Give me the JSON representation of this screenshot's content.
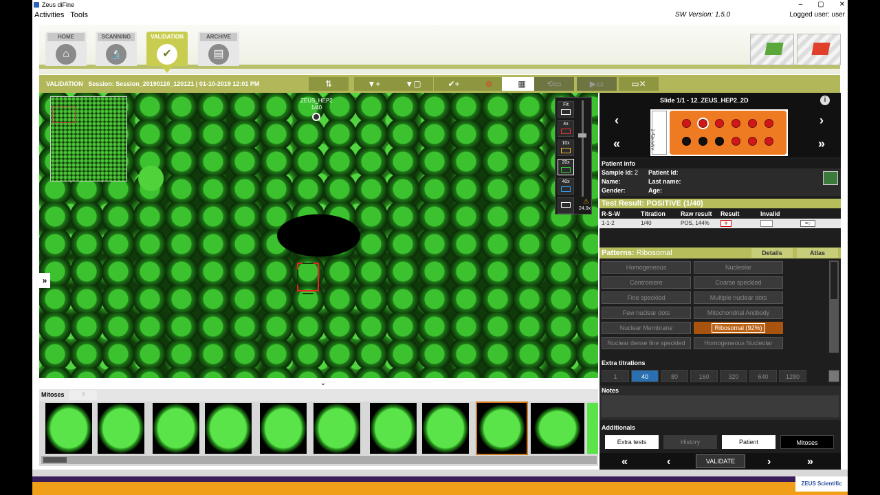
{
  "app": {
    "title": "Zeus diFine",
    "menu": [
      "Activities",
      "Tools"
    ],
    "version": "SW Version: 1.5.0",
    "user": "Logged user: user"
  },
  "window_controls": {
    "minimize": "–",
    "maximize": "▢",
    "close": "✕"
  },
  "nav": [
    {
      "label": "HOME",
      "icon": "home-icon",
      "glyph": "⌂"
    },
    {
      "label": "SCANNING",
      "icon": "microscope-icon",
      "glyph": "🔬"
    },
    {
      "label": "VALIDATION",
      "icon": "checklist-icon",
      "glyph": "✔"
    },
    {
      "label": "ARCHIVE",
      "icon": "archive-icon",
      "glyph": "▤"
    }
  ],
  "toolbar": {
    "title": "VALIDATION",
    "session": "Session: Session_20190110_120121 | 01-10-2019 12:01 PM",
    "buttons": [
      {
        "name": "sort-icon",
        "glyph": "⇅"
      },
      {
        "name": "filter-add-icon",
        "glyph": "▼+"
      },
      {
        "name": "filter-copy-icon",
        "glyph": "▼▢"
      },
      {
        "name": "check-add-icon",
        "glyph": "✔+"
      },
      {
        "name": "ban-icon",
        "glyph": "⊘"
      },
      {
        "name": "grid-icon",
        "glyph": "▦"
      },
      {
        "name": "link-icon",
        "glyph": "⟲▭"
      },
      {
        "name": "play-list-icon",
        "glyph": "▶▭"
      },
      {
        "name": "close-card-icon",
        "glyph": "▭✕"
      }
    ]
  },
  "viewer": {
    "specimen_name": "ZEUS_HEP2",
    "specimen_titer": "1/40",
    "expand_glyph": "»",
    "zoom": {
      "fit": "Fit",
      "levels": [
        "4x",
        "10x",
        "20x",
        "40x"
      ],
      "active": "20x",
      "value": "24.0x",
      "warning": "⚠"
    }
  },
  "mitoses": {
    "title": "Mitoses",
    "help": "?",
    "count": 10,
    "selected_index": 8
  },
  "slide": {
    "title": "Slide 1/1 - 12_ZEUS_HEP2_2D",
    "label": "ANA/HEp-2",
    "info": "i",
    "nav": {
      "prev": "‹",
      "next": "›",
      "first": "«",
      "last": "»"
    },
    "wells": [
      {
        "n": "1",
        "state": "red"
      },
      {
        "n": "2",
        "state": "selected"
      },
      {
        "n": "3",
        "state": "red"
      },
      {
        "n": "4",
        "state": "red"
      },
      {
        "n": "5",
        "state": "red"
      },
      {
        "n": "6",
        "state": "red"
      },
      {
        "n": "12",
        "state": "black"
      },
      {
        "n": "11",
        "state": "black"
      },
      {
        "n": "10",
        "state": "black"
      },
      {
        "n": "9",
        "state": "red"
      },
      {
        "n": "8",
        "state": "red"
      },
      {
        "n": "7",
        "state": "red"
      }
    ]
  },
  "patient": {
    "header": "Patient info",
    "sample_id_label": "Sample Id:",
    "sample_id": "2",
    "name_label": "Name:",
    "gender_label": "Gender:",
    "patient_id_label": "Patient Id:",
    "last_name_label": "Last name:",
    "age_label": "Age:"
  },
  "test_result": {
    "header": "Test Result: POSITIVE (1/40)",
    "columns": [
      "R-S-W",
      "Titration",
      "Raw result",
      "Result",
      "Invalid"
    ],
    "row": {
      "rsw": "1-1-2",
      "titration": "1/40",
      "raw": "POS, 144%",
      "result": "+",
      "icon": "≡○"
    }
  },
  "patterns": {
    "label": "Patterns:",
    "value": "Ribosomal",
    "tabs": [
      "Details",
      "Atlas"
    ],
    "items": [
      "Homogeneous",
      "Nucleolar",
      "Centromere",
      "Coarse speckled",
      "Fine speckled",
      "Multiple nuclear dots",
      "Few nuclear dots",
      "Mitochondrial Antibody",
      "Nuclear Membrane",
      "Ribosomal (92%)",
      "Nuclear dense fine speckled",
      "Homogeneous Nucleolar"
    ],
    "active_index": 9
  },
  "extra_titrations": {
    "header": "Extra titrations",
    "values": [
      "1",
      "40",
      "80",
      "160",
      "320",
      "640",
      "1280"
    ],
    "active": "40"
  },
  "notes": {
    "header": "Notes"
  },
  "additionals": {
    "header": "Additionals",
    "buttons": [
      {
        "label": "Extra tests",
        "style": "white"
      },
      {
        "label": "History",
        "style": "dim"
      },
      {
        "label": "Patient",
        "style": "white"
      },
      {
        "label": "Mitoses",
        "style": "black"
      }
    ]
  },
  "bottom_nav": {
    "first": "«",
    "prev": "‹",
    "validate": "VALIDATE",
    "next": "›",
    "last": "»"
  },
  "footer": {
    "brand": "ZEUS Scientific"
  }
}
